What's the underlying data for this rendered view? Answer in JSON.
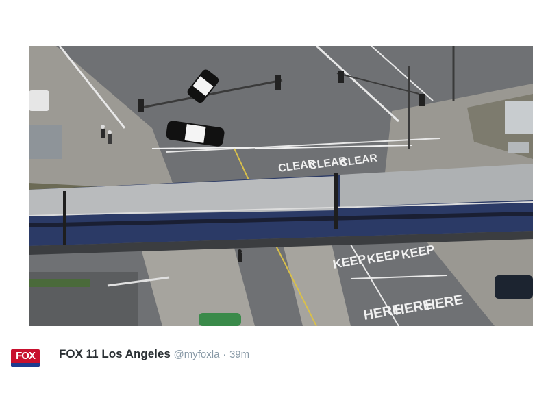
{
  "photo": {
    "road_markings": [
      "CLEAR",
      "CLEAR",
      "CLEAR",
      "KEEP",
      "KEEP",
      "KEEP",
      "HERE",
      "HERE",
      "HERE"
    ]
  },
  "tweet": {
    "avatar_text": "FOX",
    "account_name": "FOX 11 Los Angeles",
    "handle": "@myfoxla",
    "separator": "·",
    "time": "39m"
  },
  "colors": {
    "asphalt": "#6f7174",
    "train_roof": "#b9bbbd",
    "train_body": "#2b3a66",
    "fox_red": "#c8102e"
  }
}
